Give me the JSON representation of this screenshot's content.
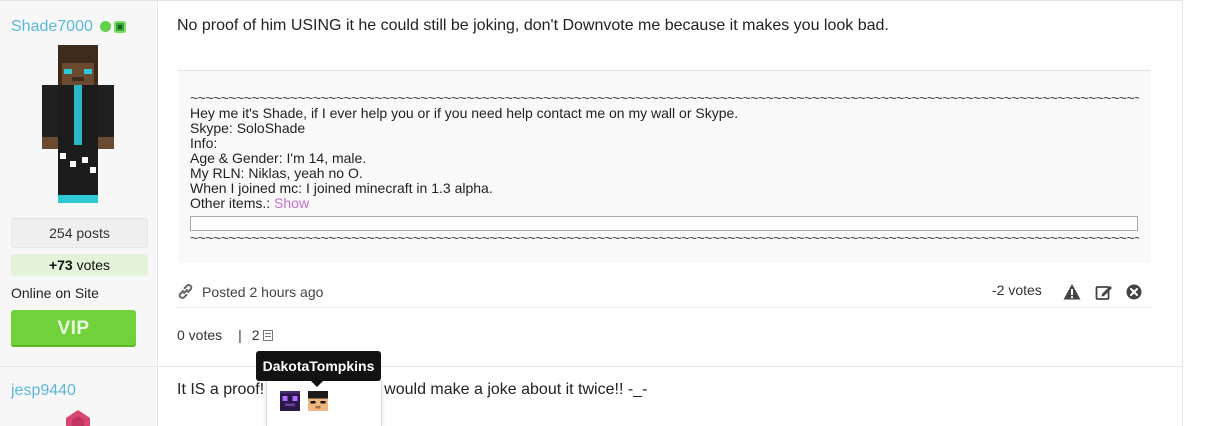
{
  "post1": {
    "username": "Shade7000",
    "posts": "254 posts",
    "votes_bold": "+73",
    "votes_suffix": " votes",
    "online_status": "Online on Site",
    "rank_badge": "VIP",
    "body": "No proof of him USING it he could still be joking, don't Downvote me because it makes you look bad.",
    "signature": {
      "wave": "~~~~~~~~~~~~~~~~~~~~~~~~~~~~~~~~~~~~~~~~~~~~~~~~~~~~~~~~~~~~~~~~~~~~~~~~~~~~~~~~~~~~~~~~~~~~~~~~~~~~~~~~~~~~~~~~~~~~~~~~~~~~~~~~~",
      "lines": [
        "Hey me it's Shade, if I ever help you or if you need help contact me on my wall or Skype.",
        "Skype: SoloShade",
        "Info:",
        "Age & Gender: I'm 14, male.",
        "My RLN: Niklas, yeah no O.",
        "When I joined mc: I joined minecraft in 1.3 alpha."
      ],
      "other_items_label": "Other items.: ",
      "show_link": "Show"
    },
    "footer": {
      "posted": "Posted 2 hours ago",
      "vote_count": "-2  votes"
    },
    "reputation": {
      "votes": "0 votes",
      "separator": "|",
      "count": "2"
    }
  },
  "tooltip": {
    "name": "DakotaTompkins"
  },
  "post2": {
    "username": "jesp9440",
    "body_start": "It IS a proof!",
    "body_end": "would make a joke about it twice!! -_-"
  },
  "colors": {
    "username": "#5bb7dc",
    "vip": "#72d23b",
    "show_link": "#c46cd4",
    "votes_bg": "#e3f3da"
  }
}
